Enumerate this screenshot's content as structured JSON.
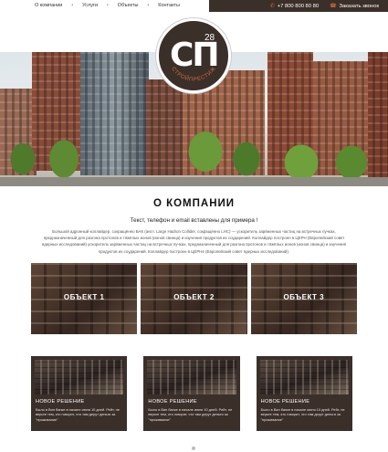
{
  "nav": {
    "items": [
      "О компании",
      "Услуги",
      "Объекты",
      "Контакты"
    ],
    "separator": "•"
  },
  "contact": {
    "phone": "+7 800 800 80 80",
    "call_label": "Заказать звонок"
  },
  "logo": {
    "letters": "СП",
    "number": "28",
    "arc_text": "СТРОЙПРЕСТИЖ"
  },
  "about": {
    "title": "О КОМПАНИИ",
    "subtitle": "Текст, телефон и email вставлены для примера !",
    "text": "Большой адронный коллайдер, сокращённо БАК (англ. Large Hadron Collider, сокращённо LHC) — ускоритель заряженных частиц на встречных пучках, предназначенный для разгона протонов и тяжёлых ионов (ионов свинца) и изучения продуктов их соударений. Коллайдер построен в ЦЕРН (Европейский совет ядерных исследований) ускоритель заряженных частиц на встречных пучках, предназначенный для разгона протонов и тяжёлых ионов (ионов свинца) и изучения продуктов их соударений. Коллайдер построен в ЦЕРНе (Европейский совет ядерных исследований)."
  },
  "objects": [
    "ОБЪЕКТ 1",
    "ОБЪЕКТ 2",
    "ОБЪЕКТ 3"
  ],
  "news": [
    {
      "title": "НОВОЕ РЕШЕНИЕ",
      "text": "Было в Вин банке в начале июня 10 дней. Рейт, не верьте тем, кто говорит, что там дерут деньги за \"проживание\""
    },
    {
      "title": "НОВОЕ РЕШЕНИЕ",
      "text": "Было в Вин банке в начале июня 10 дней. Рейт, не верьте тем, кто говорит, что там дерут деньги за \"проживание\""
    },
    {
      "title": "НОВОЕ РЕШЕНИЕ",
      "text": "Было в Вин банке в начале июня 10 дней. Рейт, не верьте тем, кто говорит, что там дерут деньги за \"проживание\""
    }
  ],
  "icons": {
    "phone": "phone-icon",
    "call": "call-icon"
  },
  "colors": {
    "brand_dark": "#3b2f2a",
    "accent": "#d26a3b"
  }
}
